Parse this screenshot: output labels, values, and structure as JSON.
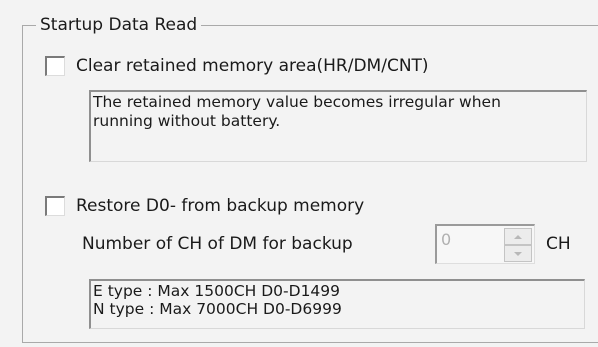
{
  "group": {
    "title": "Startup Data Read"
  },
  "clear_retained": {
    "label": "Clear retained memory area(HR/DM/CNT)",
    "checked": false,
    "note_lines": [
      "The retained memory value becomes irregular when",
      "running without battery."
    ]
  },
  "restore_backup": {
    "label": "Restore D0- from backup memory",
    "checked": false,
    "ch_label": "Number of CH of DM for backup",
    "ch_value": "0",
    "ch_unit": "CH",
    "info_lines": [
      "E type : Max 1500CH   D0-D1499",
      "N type : Max 7000CH   D0-D6999"
    ]
  },
  "icons": {
    "spin_up": "spin-up-arrow-icon",
    "spin_down": "spin-down-arrow-icon"
  },
  "colors": {
    "background": "#f3f3f3",
    "disabled_text": "#b0b0b0"
  }
}
